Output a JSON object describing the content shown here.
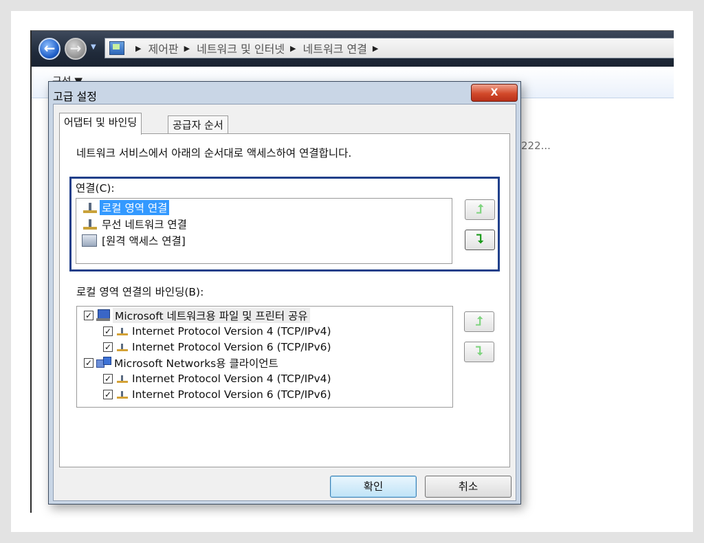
{
  "explorer": {
    "breadcrumb": [
      "제어판",
      "네트워크 및 인터넷",
      "네트워크 연결"
    ],
    "toolbar_label": "구성 ▼",
    "background_text": "222..."
  },
  "dialog": {
    "title": "고급 설정",
    "close_label": "X",
    "tabs": [
      "어댑터 및 바인딩",
      "공급자 순서"
    ],
    "description": "네트워크 서비스에서 아래의 순서대로 액세스하여 연결합니다.",
    "connections_label": "연결(C):",
    "connections": [
      {
        "label": "로컬 영역 연결",
        "icon": "network-adapter-icon",
        "selected": true
      },
      {
        "label": "무선 네트워크 연결",
        "icon": "network-adapter-icon",
        "selected": false
      },
      {
        "label": "[원격 액세스 연결]",
        "icon": "dialup-icon",
        "selected": false
      }
    ],
    "bindings_label": "로컬 영역 연결의 바인딩(B):",
    "bindings": [
      {
        "label": "Microsoft 네트워크용 파일 및 프린터 공유",
        "checked": true,
        "level": 0,
        "icon": "file-printer-sharing-icon"
      },
      {
        "label": "Internet Protocol Version 4 (TCP/IPv4)",
        "checked": true,
        "level": 1,
        "icon": "protocol-icon"
      },
      {
        "label": "Internet Protocol Version 6 (TCP/IPv6)",
        "checked": true,
        "level": 1,
        "icon": "protocol-icon"
      },
      {
        "label": "Microsoft Networks용 클라이언트",
        "checked": true,
        "level": 0,
        "icon": "network-client-icon"
      },
      {
        "label": "Internet Protocol Version 4 (TCP/IPv4)",
        "checked": true,
        "level": 1,
        "icon": "protocol-icon"
      },
      {
        "label": "Internet Protocol Version 6 (TCP/IPv6)",
        "checked": true,
        "level": 1,
        "icon": "protocol-icon"
      }
    ],
    "ok_label": "확인",
    "cancel_label": "취소"
  }
}
